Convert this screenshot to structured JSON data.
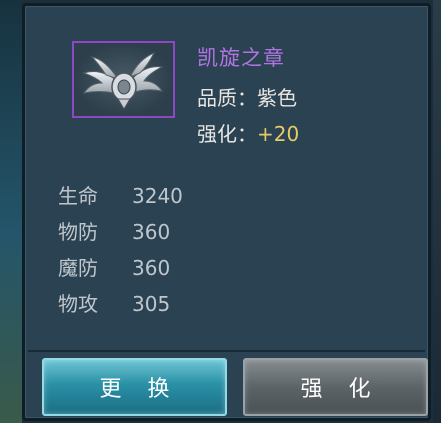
{
  "item": {
    "name": "凯旋之章",
    "quality_label": "品质：",
    "quality_value": "紫色",
    "enhance_label": "强化：",
    "enhance_value": "+20",
    "icon": "winged-medal-icon",
    "frame_color": "#8d48c7",
    "name_color": "#b174e2"
  },
  "stats": [
    {
      "label": "生命",
      "value": "3240"
    },
    {
      "label": "物防",
      "value": "360"
    },
    {
      "label": "魔防",
      "value": "360"
    },
    {
      "label": "物攻",
      "value": "305"
    }
  ],
  "buttons": {
    "swap_label": "更换",
    "enhance_label": "强化"
  }
}
